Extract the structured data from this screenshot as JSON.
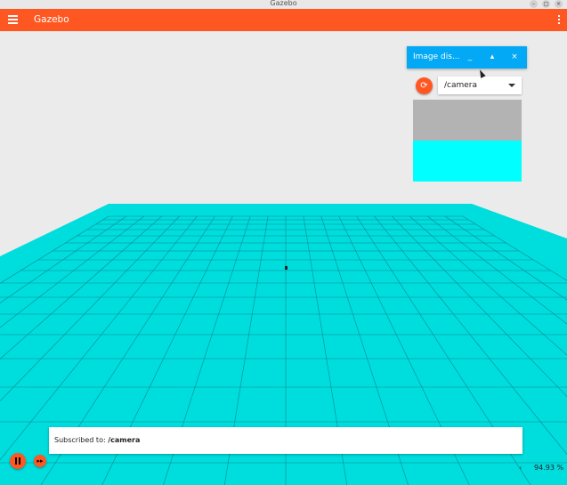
{
  "window": {
    "title": "Gazebo"
  },
  "appbar": {
    "title": "Gazebo"
  },
  "image_display": {
    "title": "Image dis...",
    "minimize_label": "_",
    "expand_label": "▴",
    "close_label": "×",
    "refresh_icon": "⟳",
    "topic": "/camera"
  },
  "scene": {
    "background_color": "#ebebeb",
    "ground_color": "#00dddd"
  },
  "status": {
    "label": "Subscribed to: ",
    "topic": "/camera"
  },
  "controls": {
    "step_label": "▸▸",
    "rtf_arrow": "‹",
    "real_time_factor": "94.93 %"
  }
}
